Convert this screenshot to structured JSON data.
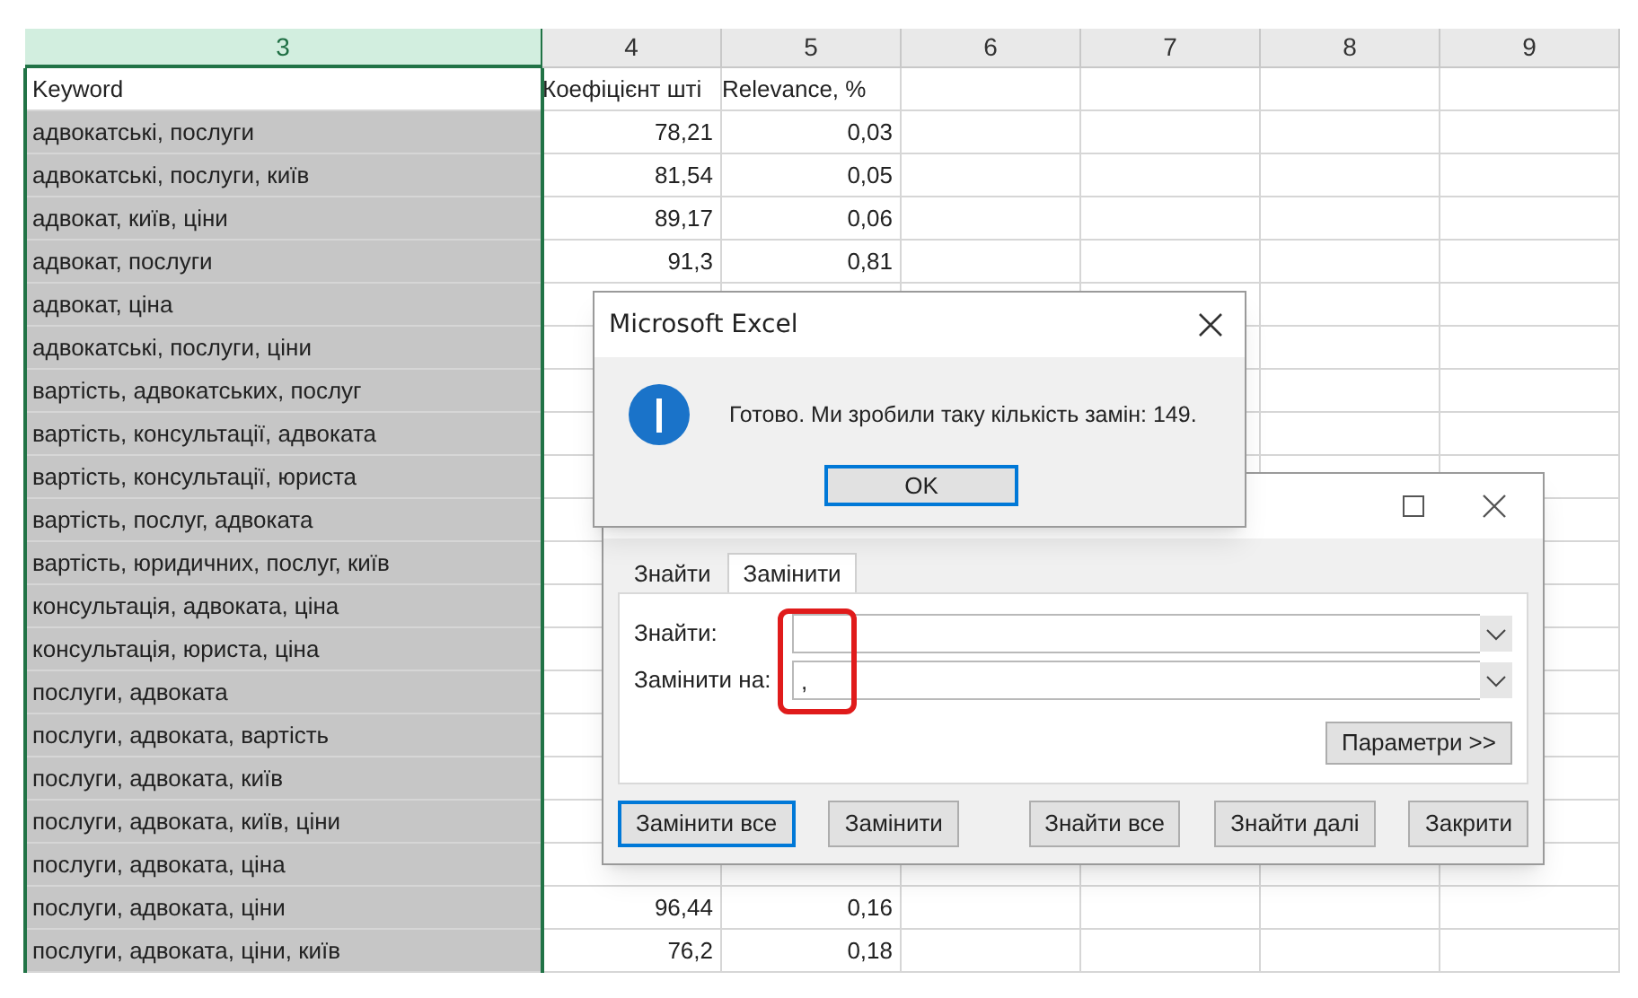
{
  "sheet": {
    "columns": [
      {
        "label": "3",
        "selected": true
      },
      {
        "label": "4",
        "selected": false
      },
      {
        "label": "5",
        "selected": false
      },
      {
        "label": "6",
        "selected": false
      },
      {
        "label": "7",
        "selected": false
      },
      {
        "label": "8",
        "selected": false
      },
      {
        "label": "9",
        "selected": false
      }
    ],
    "rows": [
      {
        "keyword": "Keyword",
        "selected": false,
        "col4": "Коефіцієнт шті",
        "col5": "Relevance, %",
        "kind": "header"
      },
      {
        "keyword": "адвокатські, послуги",
        "selected": true,
        "col4": "78,21",
        "col5": "0,03",
        "kind": "number"
      },
      {
        "keyword": "адвокатські, послуги, київ",
        "selected": true,
        "col4": "81,54",
        "col5": "0,05",
        "kind": "number"
      },
      {
        "keyword": "адвокат, київ, ціни",
        "selected": true,
        "col4": "89,17",
        "col5": "0,06",
        "kind": "number"
      },
      {
        "keyword": "адвокат, послуги",
        "selected": true,
        "col4": "91,3",
        "col5": "0,81",
        "kind": "number"
      },
      {
        "keyword": "адвокат, ціна",
        "selected": true
      },
      {
        "keyword": "адвокатські, послуги, ціни",
        "selected": true
      },
      {
        "keyword": "вартість, адвокатських, послуг",
        "selected": true
      },
      {
        "keyword": "вартість, консультації, адвоката",
        "selected": true
      },
      {
        "keyword": "вартість, консультації, юриста",
        "selected": true
      },
      {
        "keyword": "вартість, послуг, адвоката",
        "selected": true
      },
      {
        "keyword": "вартість, юридичних, послуг, київ",
        "selected": true
      },
      {
        "keyword": "консультація, адвоката, ціна",
        "selected": true
      },
      {
        "keyword": "консультація, юриста, ціна",
        "selected": true
      },
      {
        "keyword": "послуги, адвоката",
        "selected": true
      },
      {
        "keyword": "послуги, адвоката, вартість",
        "selected": true
      },
      {
        "keyword": "послуги, адвоката, київ",
        "selected": true
      },
      {
        "keyword": "послуги, адвоката, київ, ціни",
        "selected": true
      },
      {
        "keyword": "послуги, адвоката, ціна",
        "selected": true
      },
      {
        "keyword": "послуги, адвоката, ціни",
        "selected": true,
        "col4": "96,44",
        "col5": "0,16",
        "kind": "number"
      },
      {
        "keyword": "послуги, адвоката, ціни, київ",
        "selected": true,
        "col4": "76,2",
        "col5": "0,18",
        "kind": "number"
      }
    ]
  },
  "message_box": {
    "title": "Microsoft Excel",
    "message": "Готово. Ми зробили таку кількість замін: 149.",
    "button": "OK"
  },
  "find_replace": {
    "tabs": [
      {
        "label": "Знайти",
        "selected": false
      },
      {
        "label": "Замінити",
        "selected": true
      }
    ],
    "fields": [
      {
        "label": "Знайти:"
      },
      {
        "label": "Замінити на:",
        "value": ","
      }
    ],
    "options_button": "Параметри >>",
    "buttons": [
      {
        "label": "Замінити все",
        "default": true
      },
      {
        "label": "Замінити",
        "default": false
      },
      {
        "label": "Знайти все",
        "default": false
      },
      {
        "label": "Знайти далі",
        "default": false
      },
      {
        "label": "Закрити",
        "default": false
      }
    ]
  }
}
